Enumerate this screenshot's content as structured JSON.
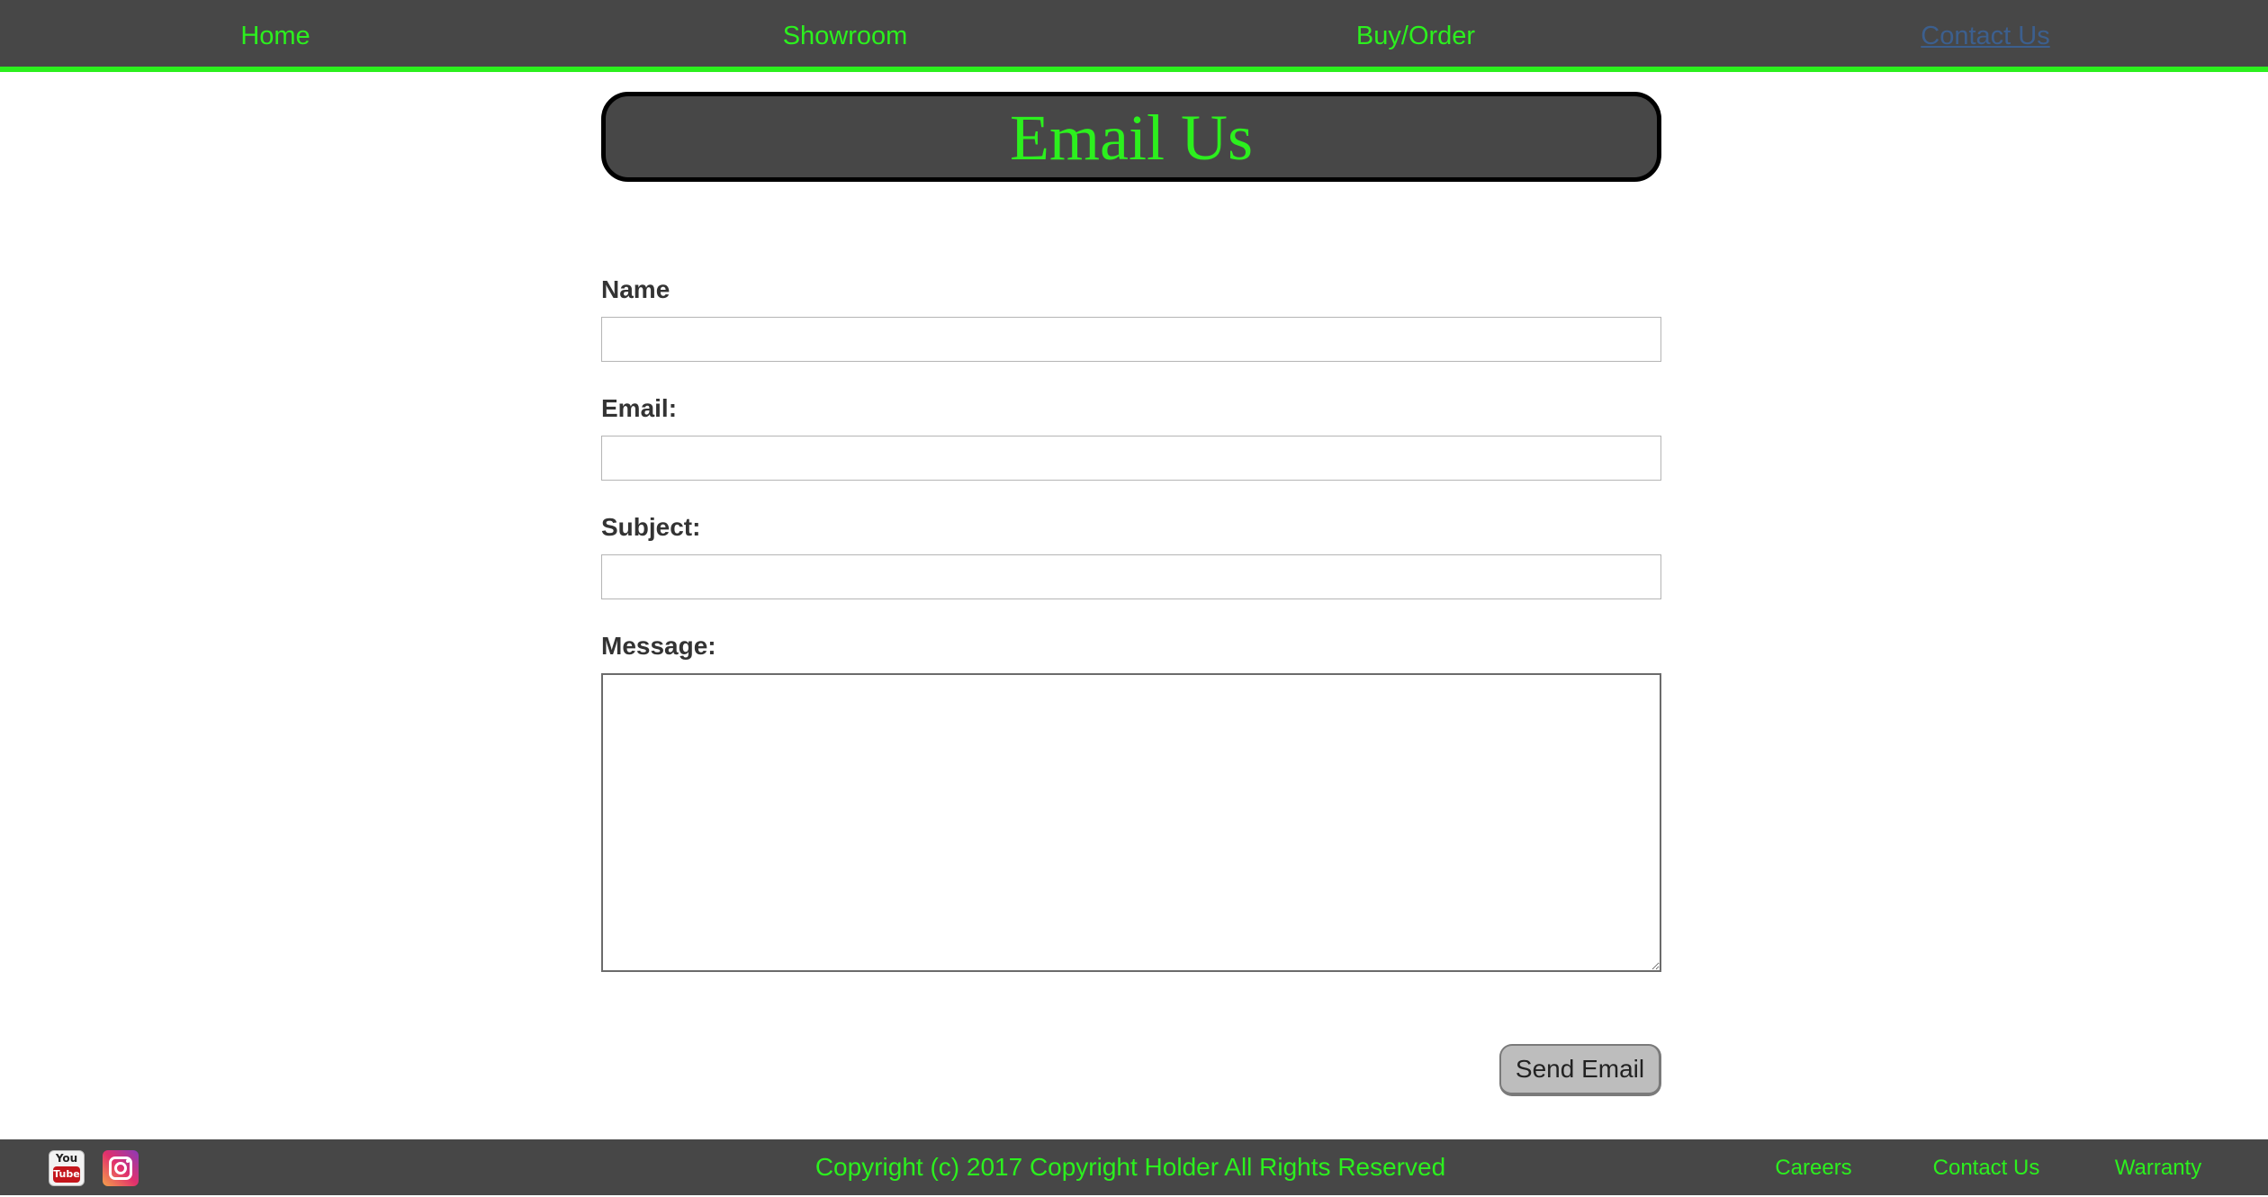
{
  "nav": {
    "items": [
      {
        "label": "Home"
      },
      {
        "label": "Showroom"
      },
      {
        "label": "Buy/Order"
      },
      {
        "label": "Contact Us"
      }
    ]
  },
  "page": {
    "title": "Email Us"
  },
  "form": {
    "name_label": "Name",
    "email_label": "Email:",
    "subject_label": "Subject:",
    "message_label": "Message:",
    "name_value": "",
    "email_value": "",
    "subject_value": "",
    "message_value": "",
    "send_label": "Send Email"
  },
  "footer": {
    "copyright": "Copyright (c) 2017 Copyright Holder All Rights Reserved",
    "links": [
      {
        "label": "Careers"
      },
      {
        "label": "Contact Us"
      },
      {
        "label": "Warranty"
      }
    ],
    "social": {
      "youtube_top": "You",
      "youtube_bottom": "Tube"
    }
  },
  "colors": {
    "accent": "#2cf01e",
    "bar": "#474747",
    "active_link": "#3c5f8e"
  }
}
